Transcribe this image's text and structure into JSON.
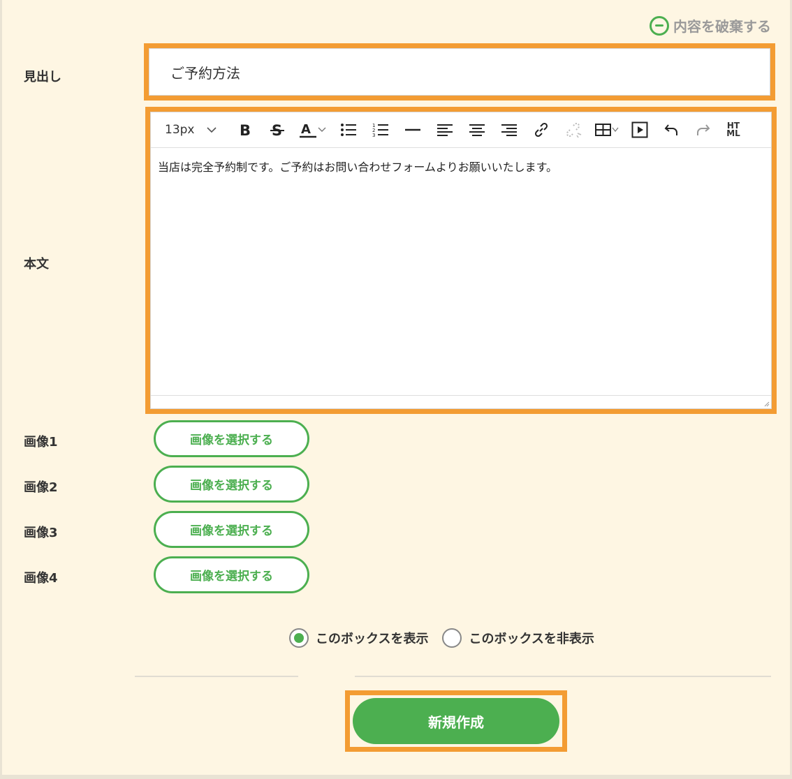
{
  "discard_label": "内容を破棄する",
  "heading": {
    "label": "見出し",
    "value": "ご予約方法"
  },
  "body": {
    "label": "本文",
    "font_size": "13px",
    "text": "当店は完全予約制です。ご予約はお問い合わせフォームよりお願いいたします。",
    "toolbar_icons": [
      "bold-icon",
      "strikethrough-icon",
      "font-color-icon",
      "bullet-list-icon",
      "numbered-list-icon",
      "horizontal-rule-icon",
      "align-left-icon",
      "align-center-icon",
      "align-right-icon",
      "link-icon",
      "unlink-icon",
      "table-icon",
      "video-icon",
      "undo-icon",
      "redo-icon",
      "html-icon"
    ],
    "html_label_top": "HT",
    "html_label_bottom": "ML"
  },
  "images": [
    {
      "label": "画像1",
      "button": "画像を選択する"
    },
    {
      "label": "画像2",
      "button": "画像を選択する"
    },
    {
      "label": "画像3",
      "button": "画像を選択する"
    },
    {
      "label": "画像4",
      "button": "画像を選択する"
    }
  ],
  "visibility": {
    "show_label": "このボックスを表示",
    "hide_label": "このボックスを非表示",
    "selected": "show"
  },
  "create_button": "新規作成",
  "colors": {
    "accent": "#4caf50",
    "highlight": "#f39c33",
    "background": "#fef6e3"
  }
}
